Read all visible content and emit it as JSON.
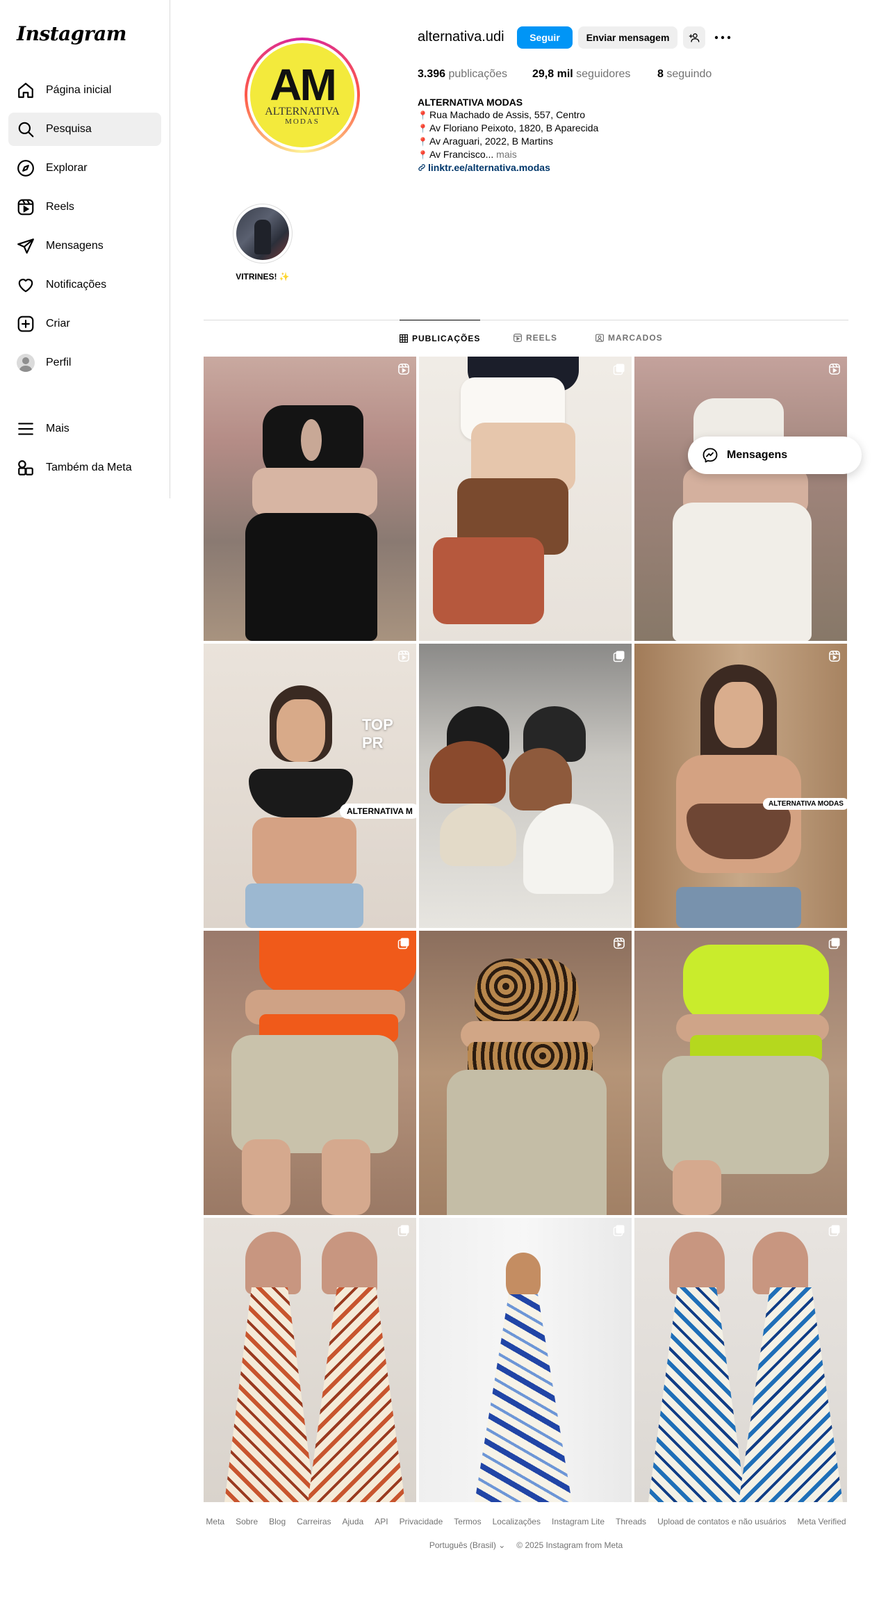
{
  "app": {
    "logo_text": "Instagram"
  },
  "sidebar": {
    "items": [
      {
        "label": "Página inicial",
        "icon": "home-icon"
      },
      {
        "label": "Pesquisa",
        "icon": "search-icon",
        "active": true
      },
      {
        "label": "Explorar",
        "icon": "compass-icon"
      },
      {
        "label": "Reels",
        "icon": "reels-icon"
      },
      {
        "label": "Mensagens",
        "icon": "send-icon"
      },
      {
        "label": "Notificações",
        "icon": "heart-icon"
      },
      {
        "label": "Criar",
        "icon": "plus-square-icon"
      },
      {
        "label": "Perfil",
        "icon": "avatar-icon"
      }
    ],
    "more": {
      "label": "Mais",
      "icon": "hamburger-icon"
    },
    "meta": {
      "label": "Também da Meta",
      "icon": "meta-apps-icon"
    }
  },
  "profile": {
    "username": "alternativa.udi",
    "avatar_text": {
      "big": "AM",
      "line1": "ALTERNATIVA",
      "line2": "MODAS"
    },
    "buttons": {
      "follow": "Seguir",
      "message": "Enviar mensagem"
    },
    "stats": {
      "posts_count": "3.396",
      "posts_label": " publicações",
      "followers_count": "29,8 mil",
      "followers_label": " seguidores",
      "following_count": "8",
      "following_label": " seguindo"
    },
    "bio": {
      "name": "ALTERNATIVA MODAS",
      "lines": [
        "Rua Machado de Assis, 557, Centro",
        "Av Floriano Peixoto, 1820, B Aparecida",
        "Av Araguari, 2022, B Martins",
        "Av Francisco..."
      ],
      "more": " mais",
      "link": "linktr.ee/alternativa.modas"
    }
  },
  "highlights": [
    {
      "label": "VITRINES! ✨"
    }
  ],
  "tabs": [
    {
      "label": "PUBLICAÇÕES",
      "icon": "grid-icon",
      "active": true
    },
    {
      "label": "REELS",
      "icon": "reels-icon"
    },
    {
      "label": "MARCADOS",
      "icon": "tagged-icon"
    }
  ],
  "posts": [
    {
      "type": "reel",
      "desc": "black top and skirt"
    },
    {
      "type": "carousel",
      "desc": "folded tops"
    },
    {
      "type": "reel",
      "desc": "white top and skirt"
    },
    {
      "type": "reel",
      "desc": "black halter top",
      "overlay_text": "TOP PR",
      "sticker": "ALTERNATIVA M"
    },
    {
      "type": "carousel",
      "desc": "bralettes"
    },
    {
      "type": "reel",
      "desc": "brown bikini top",
      "sticker": "ALTERNATIVA MODAS"
    },
    {
      "type": "carousel",
      "desc": "orange top"
    },
    {
      "type": "reel",
      "desc": "leopard top"
    },
    {
      "type": "carousel",
      "desc": "lime top"
    },
    {
      "type": "carousel",
      "desc": "orange floral dresses"
    },
    {
      "type": "carousel",
      "desc": "blue floral dress"
    },
    {
      "type": "carousel",
      "desc": "blue floral dresses"
    }
  ],
  "floating_messages": {
    "label": "Mensagens",
    "icon": "messenger-icon"
  },
  "footer": {
    "links": [
      "Meta",
      "Sobre",
      "Blog",
      "Carreiras",
      "Ajuda",
      "API",
      "Privacidade",
      "Termos",
      "Localizações",
      "Instagram Lite",
      "Threads",
      "Upload de contatos e não usuários",
      "Meta Verified"
    ],
    "language": "Português (Brasil)",
    "copyright": "© 2025 Instagram from Meta"
  },
  "colors": {
    "follow_button": "#0095f6",
    "secondary_button": "#efefef",
    "link": "#00376b",
    "muted_text": "#737373",
    "border": "#dbdbdb"
  }
}
